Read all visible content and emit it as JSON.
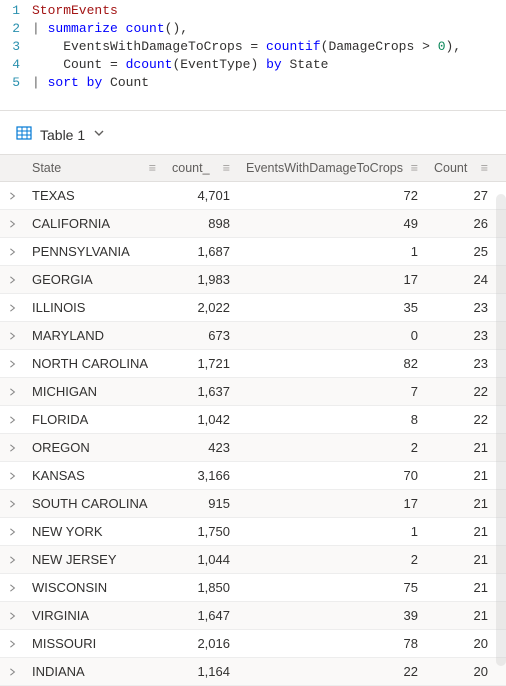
{
  "editor_lines": [
    {
      "n": 1,
      "segments": [
        {
          "cls": "t-table",
          "text": "StormEvents"
        }
      ]
    },
    {
      "n": 2,
      "segments": [
        {
          "cls": "t-pipe",
          "text": "| "
        },
        {
          "cls": "t-kw",
          "text": "summarize"
        },
        {
          "cls": "t-punc",
          "text": " "
        },
        {
          "cls": "t-func",
          "text": "count"
        },
        {
          "cls": "t-punc",
          "text": "(),"
        }
      ]
    },
    {
      "n": 3,
      "segments": [
        {
          "cls": "t-punc",
          "text": "    EventsWithDamageToCrops = "
        },
        {
          "cls": "t-func",
          "text": "countif"
        },
        {
          "cls": "t-punc",
          "text": "(DamageCrops > "
        },
        {
          "cls": "t-num",
          "text": "0"
        },
        {
          "cls": "t-punc",
          "text": "),"
        }
      ]
    },
    {
      "n": 4,
      "segments": [
        {
          "cls": "t-punc",
          "text": "    Count = "
        },
        {
          "cls": "t-func",
          "text": "dcount"
        },
        {
          "cls": "t-punc",
          "text": "(EventType) "
        },
        {
          "cls": "t-kw",
          "text": "by"
        },
        {
          "cls": "t-punc",
          "text": " State"
        }
      ]
    },
    {
      "n": 5,
      "segments": [
        {
          "cls": "t-pipe",
          "text": "| "
        },
        {
          "cls": "t-kw",
          "text": "sort"
        },
        {
          "cls": "t-punc",
          "text": " "
        },
        {
          "cls": "t-kw",
          "text": "by"
        },
        {
          "cls": "t-punc",
          "text": " Count"
        }
      ]
    }
  ],
  "tabs": {
    "table1_label": "Table 1"
  },
  "columns": {
    "state": "State",
    "count_": "count_",
    "events_damage": "EventsWithDamageToCrops",
    "count": "Count"
  },
  "chart_data": {
    "type": "table",
    "columns": [
      "State",
      "count_",
      "EventsWithDamageToCrops",
      "Count"
    ],
    "rows": [
      {
        "State": "TEXAS",
        "count_": "4,701",
        "EventsWithDamageToCrops": "72",
        "Count": "27"
      },
      {
        "State": "CALIFORNIA",
        "count_": "898",
        "EventsWithDamageToCrops": "49",
        "Count": "26"
      },
      {
        "State": "PENNSYLVANIA",
        "count_": "1,687",
        "EventsWithDamageToCrops": "1",
        "Count": "25"
      },
      {
        "State": "GEORGIA",
        "count_": "1,983",
        "EventsWithDamageToCrops": "17",
        "Count": "24"
      },
      {
        "State": "ILLINOIS",
        "count_": "2,022",
        "EventsWithDamageToCrops": "35",
        "Count": "23"
      },
      {
        "State": "MARYLAND",
        "count_": "673",
        "EventsWithDamageToCrops": "0",
        "Count": "23"
      },
      {
        "State": "NORTH CAROLINA",
        "count_": "1,721",
        "EventsWithDamageToCrops": "82",
        "Count": "23"
      },
      {
        "State": "MICHIGAN",
        "count_": "1,637",
        "EventsWithDamageToCrops": "7",
        "Count": "22"
      },
      {
        "State": "FLORIDA",
        "count_": "1,042",
        "EventsWithDamageToCrops": "8",
        "Count": "22"
      },
      {
        "State": "OREGON",
        "count_": "423",
        "EventsWithDamageToCrops": "2",
        "Count": "21"
      },
      {
        "State": "KANSAS",
        "count_": "3,166",
        "EventsWithDamageToCrops": "70",
        "Count": "21"
      },
      {
        "State": "SOUTH CAROLINA",
        "count_": "915",
        "EventsWithDamageToCrops": "17",
        "Count": "21"
      },
      {
        "State": "NEW YORK",
        "count_": "1,750",
        "EventsWithDamageToCrops": "1",
        "Count": "21"
      },
      {
        "State": "NEW JERSEY",
        "count_": "1,044",
        "EventsWithDamageToCrops": "2",
        "Count": "21"
      },
      {
        "State": "WISCONSIN",
        "count_": "1,850",
        "EventsWithDamageToCrops": "75",
        "Count": "21"
      },
      {
        "State": "VIRGINIA",
        "count_": "1,647",
        "EventsWithDamageToCrops": "39",
        "Count": "21"
      },
      {
        "State": "MISSOURI",
        "count_": "2,016",
        "EventsWithDamageToCrops": "78",
        "Count": "20"
      },
      {
        "State": "INDIANA",
        "count_": "1,164",
        "EventsWithDamageToCrops": "22",
        "Count": "20"
      }
    ]
  }
}
